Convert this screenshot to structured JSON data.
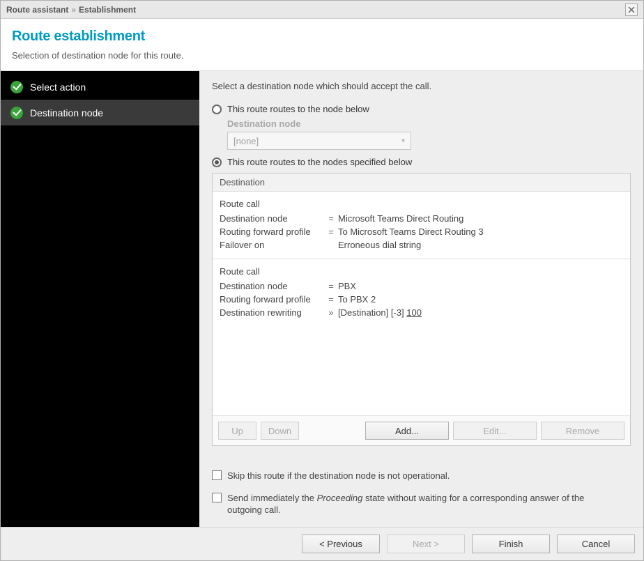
{
  "titlebar": {
    "app": "Route assistant",
    "section": "Establishment"
  },
  "header": {
    "title": "Route establishment",
    "subtitle": "Selection of destination node for this route."
  },
  "sidebar": {
    "items": [
      {
        "label": "Select action"
      },
      {
        "label": "Destination node"
      }
    ]
  },
  "main": {
    "instruction": "Select a destination node which should accept the call.",
    "option_single": {
      "label": "This route routes to the node below",
      "sublabel": "Destination node",
      "value": "[none]"
    },
    "option_multi": {
      "label": "This route routes to the nodes specified below",
      "header": "Destination",
      "entries": [
        {
          "headline": "Route call",
          "rows": [
            {
              "k": "Destination node",
              "eq": "=",
              "v": "Microsoft Teams Direct Routing"
            },
            {
              "k": "Routing forward profile",
              "eq": "=",
              "v": "To Microsoft Teams Direct Routing 3"
            },
            {
              "k": "Failover on",
              "eq": "",
              "v": "Erroneous dial string"
            }
          ]
        },
        {
          "headline": "Route call",
          "rows": [
            {
              "k": "Destination node",
              "eq": "=",
              "v": "PBX"
            },
            {
              "k": "Routing forward profile",
              "eq": "=",
              "v": "To PBX 2"
            },
            {
              "k": "Destination rewriting",
              "eq": "»",
              "v_prefix": "[Destination] [-3] ",
              "v_num": "100"
            }
          ]
        }
      ],
      "buttons": {
        "up": "Up",
        "down": "Down",
        "add": "Add...",
        "edit": "Edit...",
        "remove": "Remove"
      }
    },
    "checkbox_skip": "Skip this route if the destination node is not operational.",
    "checkbox_proceed_pre": "Send immediately the ",
    "checkbox_proceed_em": "Proceeding",
    "checkbox_proceed_post": " state without waiting for a corresponding answer of the outgoing call."
  },
  "footer": {
    "previous": "< Previous",
    "next": "Next >",
    "finish": "Finish",
    "cancel": "Cancel"
  }
}
